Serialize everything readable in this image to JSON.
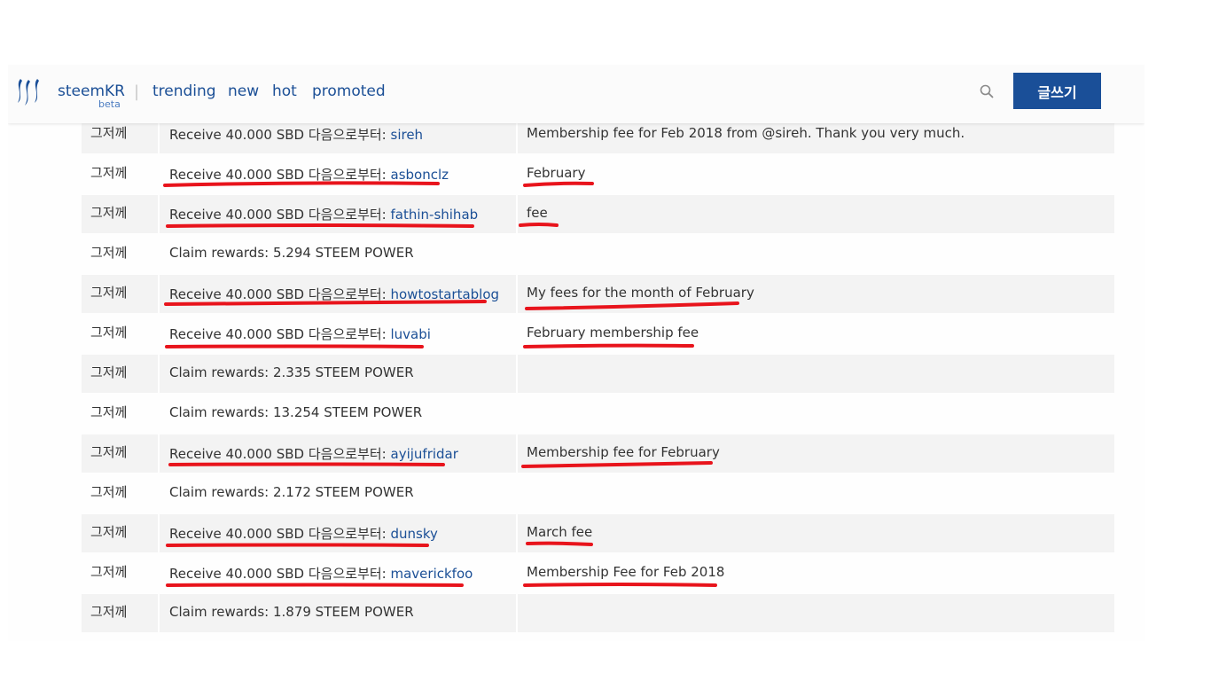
{
  "header": {
    "brand": "steemKR",
    "beta": "beta",
    "separator": "|",
    "nav": [
      "trending",
      "new",
      "hot",
      "promoted"
    ],
    "write_button": "글쓰기",
    "search_icon": "search-icon",
    "logo_icon": "steem-logo-icon"
  },
  "colors": {
    "accent": "#1a4f98",
    "link": "#1b4f96",
    "annotation": "#e8141c",
    "row_shade": "#f3f3f3"
  },
  "rows": [
    {
      "date": "그저께",
      "prefix": "Receive 40.000 SBD 다음으로부터: ",
      "user": "sireh",
      "memo": "Membership fee for Feb 2018 from @sireh. Thank you very much."
    },
    {
      "date": "그저께",
      "prefix": "Receive 40.000 SBD 다음으로부터: ",
      "user": "asbonclz",
      "memo": "February"
    },
    {
      "date": "그저께",
      "prefix": "Receive 40.000 SBD 다음으로부터: ",
      "user": "fathin-shihab",
      "memo": "fee"
    },
    {
      "date": "그저께",
      "prefix": "Claim rewards: 5.294 STEEM POWER",
      "user": "",
      "memo": ""
    },
    {
      "date": "그저께",
      "prefix": "Receive 40.000 SBD 다음으로부터: ",
      "user": "howtostartablog",
      "memo": "My fees for the month of February"
    },
    {
      "date": "그저께",
      "prefix": "Receive 40.000 SBD 다음으로부터: ",
      "user": "luvabi",
      "memo": "February membership fee"
    },
    {
      "date": "그저께",
      "prefix": "Claim rewards: 2.335 STEEM POWER",
      "user": "",
      "memo": ""
    },
    {
      "date": "그저께",
      "prefix": "Claim rewards: 13.254 STEEM POWER",
      "user": "",
      "memo": ""
    },
    {
      "date": "그저께",
      "prefix": "Receive 40.000 SBD 다음으로부터: ",
      "user": "ayijufridar",
      "memo": "Membership fee for February"
    },
    {
      "date": "그저께",
      "prefix": "Claim rewards: 2.172 STEEM POWER",
      "user": "",
      "memo": ""
    },
    {
      "date": "그저께",
      "prefix": "Receive 40.000 SBD 다음으로부터: ",
      "user": "dunsky",
      "memo": "March fee"
    },
    {
      "date": "그저께",
      "prefix": "Receive 40.000 SBD 다음으로부터: ",
      "user": "maverickfoo",
      "memo": "Membership Fee for Feb 2018"
    },
    {
      "date": "그저께",
      "prefix": "Claim rewards: 1.879 STEEM POWER",
      "user": "",
      "memo": ""
    }
  ]
}
